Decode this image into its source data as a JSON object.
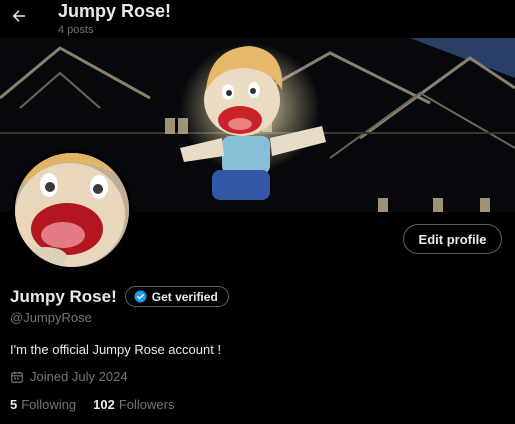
{
  "header": {
    "title": "Jumpy Rose!",
    "posts_count": "4 posts"
  },
  "profile": {
    "display_name": "Jumpy Rose!",
    "verify_label": "Get verified",
    "handle": "@JumpyRose",
    "bio": "I'm the official Jumpy Rose account !",
    "joined": "Joined July 2024",
    "following_count": "5",
    "following_label": "Following",
    "followers_count": "102",
    "followers_label": "Followers"
  },
  "actions": {
    "edit_profile_label": "Edit profile"
  },
  "icons": {
    "back": "arrow-left-icon",
    "verified": "verified-badge-icon",
    "calendar": "calendar-icon"
  },
  "colors": {
    "background": "#000000",
    "text_primary": "#e7e9ea",
    "text_secondary": "#71767b",
    "border": "#536471",
    "accent": "#1d9bf0"
  }
}
